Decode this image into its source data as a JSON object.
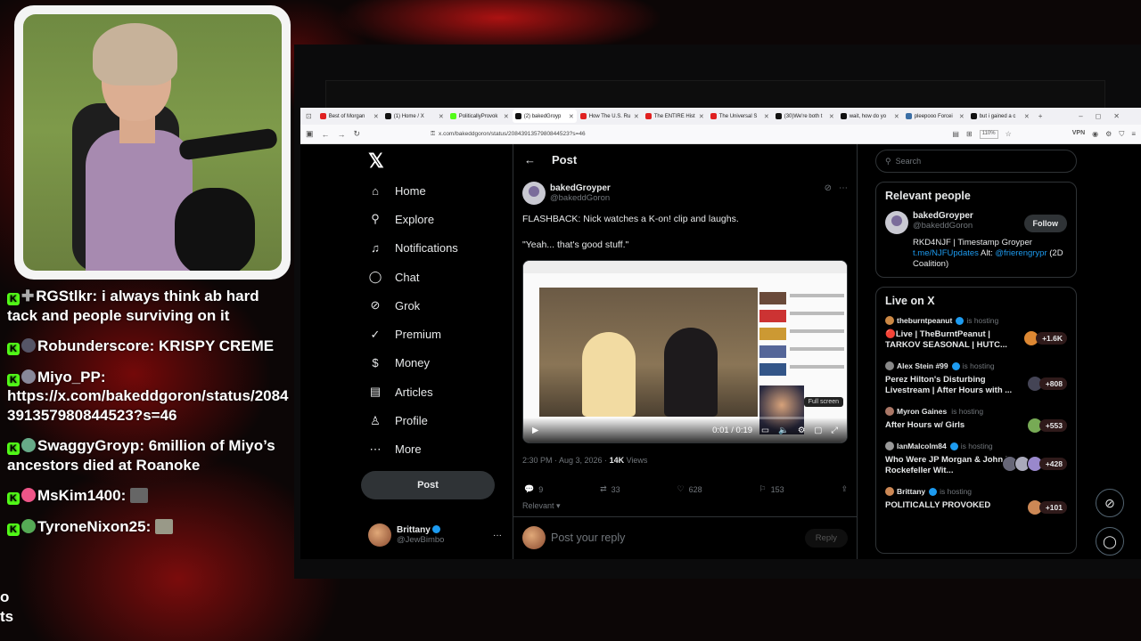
{
  "chat": {
    "messages": [
      {
        "user": "RGStlkr",
        "text": "i always think ab hard tack and people surviving on it"
      },
      {
        "user": "Robunderscore",
        "text": "KRISPY CREME"
      },
      {
        "user": "Miyo_PP",
        "text": "https://x.com/bakeddgoron/status/2084391357980844523?s=46"
      },
      {
        "user": "SwaggyGroyp",
        "text": "6million of Miyo’s ancestors died at Roanoke"
      },
      {
        "user": "MsKim1400",
        "text": ""
      },
      {
        "user": "TyroneNixon25",
        "text": ""
      }
    ],
    "cutoff": "o\nts"
  },
  "browser": {
    "tabs": [
      {
        "label": "Best of Morgan",
        "color": "#e02020"
      },
      {
        "label": "(1) Home / X",
        "color": "#111111"
      },
      {
        "label": "PoliticallyProvok",
        "color": "#53fc18"
      },
      {
        "label": "(2) bakedGroyp",
        "color": "#111111"
      },
      {
        "label": "How The U.S. Ru",
        "color": "#e02020"
      },
      {
        "label": "The ENTIRE Hist",
        "color": "#e02020"
      },
      {
        "label": "The Universal S",
        "color": "#e02020"
      },
      {
        "label": "(30)We're both t",
        "color": "#111111"
      },
      {
        "label": "wait, how do yo",
        "color": "#111111"
      },
      {
        "label": "pleepooo Forcei",
        "color": "#3a6ea5"
      },
      {
        "label": "but i gained a c",
        "color": "#111111"
      }
    ],
    "active_tab": 3,
    "url": "x.com/bakeddgoron/status/2084391357980844523?s=46",
    "zoom": "110%",
    "vpn": "VPN"
  },
  "nav": {
    "items": [
      {
        "label": "Home",
        "icon": "home-icon",
        "glyph": "⌂"
      },
      {
        "label": "Explore",
        "icon": "search-icon",
        "glyph": "⚲"
      },
      {
        "label": "Notifications",
        "icon": "bell-icon",
        "glyph": "🔔"
      },
      {
        "label": "Chat",
        "icon": "chat-icon",
        "glyph": "◯"
      },
      {
        "label": "Grok",
        "icon": "grok-icon",
        "glyph": "⊘"
      },
      {
        "label": "Premium",
        "icon": "premium-icon",
        "glyph": "✓"
      },
      {
        "label": "Money",
        "icon": "money-icon",
        "glyph": "$"
      },
      {
        "label": "Articles",
        "icon": "articles-icon",
        "glyph": "▤"
      },
      {
        "label": "Profile",
        "icon": "profile-icon",
        "glyph": "♙"
      },
      {
        "label": "More",
        "icon": "more-icon",
        "glyph": "⋯"
      }
    ],
    "post_label": "Post",
    "account": {
      "name": "Brittany",
      "handle": "@JewBimbo"
    }
  },
  "post": {
    "header": "Post",
    "author_name": "bakedGroyper",
    "author_handle": "@bakeddGoron",
    "text1": "FLASHBACK: Nick watches a K-on! clip and laughs.",
    "text2": "\"Yeah... that's good stuff.\"",
    "video": {
      "time": "0:01 / 0:19",
      "fullscreen": "Full screen"
    },
    "timestamp": "2:30 PM · Aug 3, 2026 · ",
    "views": "14K",
    "views_label": " Views",
    "replies": "9",
    "reposts": "33",
    "likes": "628",
    "bookmarks": "153",
    "sort": "Relevant",
    "reply_placeholder": "Post your reply",
    "reply_button": "Reply"
  },
  "sidebar": {
    "search_placeholder": "Search",
    "relevant_title": "Relevant people",
    "person": {
      "name": "bakedGroyper",
      "handle": "@bakeddGoron",
      "follow": "Follow",
      "bio_pre": "RKD4NJF | Timestamp Groyper ",
      "bio_link1": "t.me/NJFUpdates",
      "bio_mid": " Alt: ",
      "bio_link2": "@frierengrypr",
      "bio_post": " (2D Coalition)"
    },
    "live_title": "Live on X",
    "live": [
      {
        "host": "theburntpeanut",
        "hosting": "is hosting",
        "title": "🔴Live | TheBurntPeanut | TARKOV SEASONAL | HUTC...",
        "count": "+1.6K"
      },
      {
        "host": "Alex Stein #99",
        "hosting": "is hosting",
        "title": "Perez Hilton's Disturbing Livestream | After Hours with ...",
        "count": "+808"
      },
      {
        "host": "Myron Gaines",
        "hosting": "is hosting",
        "title": "After Hours w/ Girls",
        "count": "+553"
      },
      {
        "host": "IanMalcolm84",
        "hosting": "is hosting",
        "title": "Who Were JP Morgan & John D. Rockefeller Wit...",
        "count": "+428"
      },
      {
        "host": "Brittany",
        "hosting": "is hosting",
        "title": "POLITICALLY PROVOKED",
        "count": "+101"
      }
    ]
  }
}
